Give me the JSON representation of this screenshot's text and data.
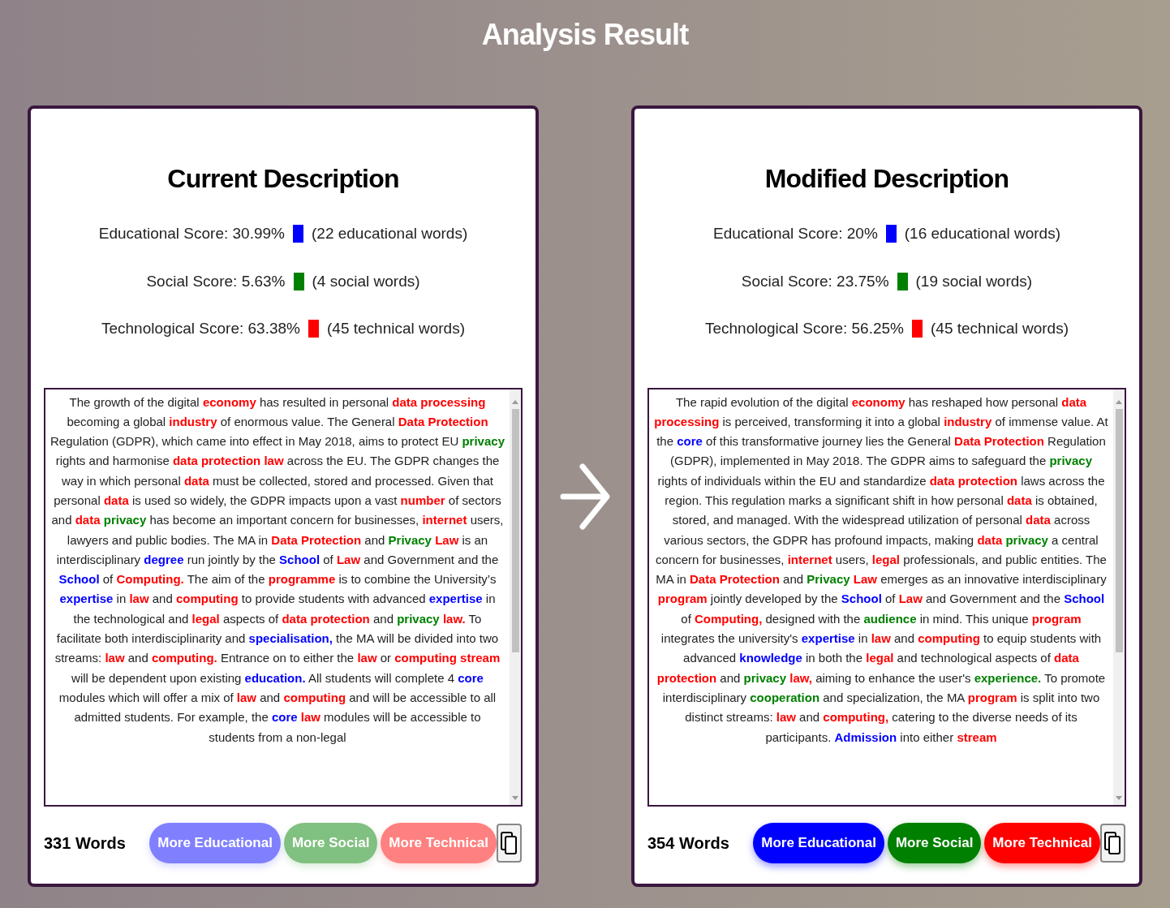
{
  "title": "Analysis Result",
  "panels": [
    {
      "heading": "Current Description",
      "scores": [
        {
          "label": "Educational Score: 30.99%",
          "color": "#0000ff",
          "count": "(22 educational words)"
        },
        {
          "label": "Social Score: 5.63%",
          "color": "#008000",
          "count": "(4 social words)"
        },
        {
          "label": "Technological Score: 63.38%",
          "color": "#ff0000",
          "count": "(45 technical words)"
        }
      ],
      "segments": [
        {
          "text": "The growth of the digital ",
          "kind": "plain"
        },
        {
          "text": "economy",
          "kind": "tech"
        },
        {
          "text": " has resulted in personal ",
          "kind": "plain"
        },
        {
          "text": "data processing",
          "kind": "tech"
        },
        {
          "text": " becoming a global ",
          "kind": "plain"
        },
        {
          "text": "industry",
          "kind": "tech"
        },
        {
          "text": " of enormous value. The General ",
          "kind": "plain"
        },
        {
          "text": "Data Protection",
          "kind": "tech"
        },
        {
          "text": " Regulation (GDPR), which came into effect in May 2018, aims to protect EU ",
          "kind": "plain"
        },
        {
          "text": "privacy",
          "kind": "social"
        },
        {
          "text": " rights and harmonise ",
          "kind": "plain"
        },
        {
          "text": "data protection law",
          "kind": "tech"
        },
        {
          "text": " across the EU. The GDPR changes the way in which personal ",
          "kind": "plain"
        },
        {
          "text": "data",
          "kind": "tech"
        },
        {
          "text": " must be collected, stored and processed. Given that personal ",
          "kind": "plain"
        },
        {
          "text": "data",
          "kind": "tech"
        },
        {
          "text": " is used so widely, the GDPR impacts upon a vast ",
          "kind": "plain"
        },
        {
          "text": "number",
          "kind": "tech"
        },
        {
          "text": " of sectors and ",
          "kind": "plain"
        },
        {
          "text": "data ",
          "kind": "tech"
        },
        {
          "text": "privacy",
          "kind": "social"
        },
        {
          "text": " has become an important concern for businesses, ",
          "kind": "plain"
        },
        {
          "text": "internet",
          "kind": "tech"
        },
        {
          "text": " users, lawyers and public bodies. The MA in ",
          "kind": "plain"
        },
        {
          "text": "Data Protection",
          "kind": "tech"
        },
        {
          "text": " and ",
          "kind": "plain"
        },
        {
          "text": "Privacy ",
          "kind": "social"
        },
        {
          "text": "Law",
          "kind": "tech"
        },
        {
          "text": " is an interdisciplinary ",
          "kind": "plain"
        },
        {
          "text": "degree",
          "kind": "edu"
        },
        {
          "text": " run jointly by the ",
          "kind": "plain"
        },
        {
          "text": "School",
          "kind": "edu"
        },
        {
          "text": " of ",
          "kind": "plain"
        },
        {
          "text": "Law",
          "kind": "tech"
        },
        {
          "text": " and Government and the ",
          "kind": "plain"
        },
        {
          "text": "School",
          "kind": "edu"
        },
        {
          "text": " of ",
          "kind": "plain"
        },
        {
          "text": "Computing.",
          "kind": "tech"
        },
        {
          "text": " The aim of the ",
          "kind": "plain"
        },
        {
          "text": "programme",
          "kind": "tech"
        },
        {
          "text": " is to combine the University’s ",
          "kind": "plain"
        },
        {
          "text": "expertise",
          "kind": "edu"
        },
        {
          "text": " in ",
          "kind": "plain"
        },
        {
          "text": "law",
          "kind": "tech"
        },
        {
          "text": " and ",
          "kind": "plain"
        },
        {
          "text": "computing",
          "kind": "tech"
        },
        {
          "text": " to provide students with advanced ",
          "kind": "plain"
        },
        {
          "text": "expertise",
          "kind": "edu"
        },
        {
          "text": " in the technological and ",
          "kind": "plain"
        },
        {
          "text": "legal",
          "kind": "tech"
        },
        {
          "text": " aspects of ",
          "kind": "plain"
        },
        {
          "text": "data protection",
          "kind": "tech"
        },
        {
          "text": " and ",
          "kind": "plain"
        },
        {
          "text": "privacy ",
          "kind": "social"
        },
        {
          "text": "law.",
          "kind": "tech"
        },
        {
          "text": " To facilitate both interdisciplinarity and ",
          "kind": "plain"
        },
        {
          "text": "specialisation,",
          "kind": "edu"
        },
        {
          "text": " the MA will be divided into two streams: ",
          "kind": "plain"
        },
        {
          "text": "law",
          "kind": "tech"
        },
        {
          "text": " and ",
          "kind": "plain"
        },
        {
          "text": "computing.",
          "kind": "tech"
        },
        {
          "text": " Entrance on to either the ",
          "kind": "plain"
        },
        {
          "text": "law",
          "kind": "tech"
        },
        {
          "text": " or ",
          "kind": "plain"
        },
        {
          "text": "computing stream",
          "kind": "tech"
        },
        {
          "text": " will be dependent upon existing ",
          "kind": "plain"
        },
        {
          "text": "education.",
          "kind": "edu"
        },
        {
          "text": " All students will complete 4 ",
          "kind": "plain"
        },
        {
          "text": "core",
          "kind": "edu"
        },
        {
          "text": " modules which will offer a mix of ",
          "kind": "plain"
        },
        {
          "text": "law",
          "kind": "tech"
        },
        {
          "text": " and ",
          "kind": "plain"
        },
        {
          "text": "computing",
          "kind": "tech"
        },
        {
          "text": " and will be accessible to all admitted students. For example, the ",
          "kind": "plain"
        },
        {
          "text": "core ",
          "kind": "edu"
        },
        {
          "text": "law",
          "kind": "tech"
        },
        {
          "text": " modules will be accessible to students from a non-legal",
          "kind": "plain"
        }
      ],
      "word_count": "331 Words",
      "buttons": [
        {
          "label": "More Educational",
          "kind": "edu",
          "disabled": true
        },
        {
          "label": "More Social",
          "kind": "social",
          "disabled": true
        },
        {
          "label": "More Technical",
          "kind": "tech",
          "disabled": true
        }
      ]
    },
    {
      "heading": "Modified Description",
      "scores": [
        {
          "label": "Educational Score: 20%",
          "color": "#0000ff",
          "count": "(16 educational words)"
        },
        {
          "label": "Social Score: 23.75%",
          "color": "#008000",
          "count": "(19 social words)"
        },
        {
          "label": "Technological Score: 56.25%",
          "color": "#ff0000",
          "count": "(45 technical words)"
        }
      ],
      "segments": [
        {
          "text": "The rapid evolution of the digital ",
          "kind": "plain"
        },
        {
          "text": "economy",
          "kind": "tech"
        },
        {
          "text": " has reshaped how personal ",
          "kind": "plain"
        },
        {
          "text": "data processing",
          "kind": "tech"
        },
        {
          "text": " is perceived, transforming it into a global ",
          "kind": "plain"
        },
        {
          "text": "industry",
          "kind": "tech"
        },
        {
          "text": " of immense value. At the ",
          "kind": "plain"
        },
        {
          "text": "core",
          "kind": "edu"
        },
        {
          "text": " of this transformative journey lies the General ",
          "kind": "plain"
        },
        {
          "text": "Data Protection",
          "kind": "tech"
        },
        {
          "text": " Regulation (GDPR), implemented in May 2018. The GDPR aims to safeguard the ",
          "kind": "plain"
        },
        {
          "text": "privacy",
          "kind": "social"
        },
        {
          "text": " rights of individuals within the EU and standardize ",
          "kind": "plain"
        },
        {
          "text": "data protection",
          "kind": "tech"
        },
        {
          "text": " laws across the region. This regulation marks a significant shift in how personal ",
          "kind": "plain"
        },
        {
          "text": "data",
          "kind": "tech"
        },
        {
          "text": " is obtained, stored, and managed. With the widespread utilization of personal ",
          "kind": "plain"
        },
        {
          "text": "data",
          "kind": "tech"
        },
        {
          "text": " across various sectors, the GDPR has profound impacts, making ",
          "kind": "plain"
        },
        {
          "text": "data ",
          "kind": "tech"
        },
        {
          "text": "privacy",
          "kind": "social"
        },
        {
          "text": " a central concern for businesses, ",
          "kind": "plain"
        },
        {
          "text": "internet",
          "kind": "tech"
        },
        {
          "text": " users, ",
          "kind": "plain"
        },
        {
          "text": "legal",
          "kind": "tech"
        },
        {
          "text": " professionals, and public entities. The MA in ",
          "kind": "plain"
        },
        {
          "text": "Data Protection",
          "kind": "tech"
        },
        {
          "text": " and ",
          "kind": "plain"
        },
        {
          "text": "Privacy ",
          "kind": "social"
        },
        {
          "text": "Law",
          "kind": "tech"
        },
        {
          "text": " emerges as an innovative interdisciplinary ",
          "kind": "plain"
        },
        {
          "text": "program",
          "kind": "tech"
        },
        {
          "text": " jointly developed by the ",
          "kind": "plain"
        },
        {
          "text": "School",
          "kind": "edu"
        },
        {
          "text": " of ",
          "kind": "plain"
        },
        {
          "text": "Law",
          "kind": "tech"
        },
        {
          "text": " and Government and the ",
          "kind": "plain"
        },
        {
          "text": "School",
          "kind": "edu"
        },
        {
          "text": " of ",
          "kind": "plain"
        },
        {
          "text": "Computing,",
          "kind": "tech"
        },
        {
          "text": " designed with the ",
          "kind": "plain"
        },
        {
          "text": "audience",
          "kind": "social"
        },
        {
          "text": " in mind. This unique ",
          "kind": "plain"
        },
        {
          "text": "program",
          "kind": "tech"
        },
        {
          "text": " integrates the university's ",
          "kind": "plain"
        },
        {
          "text": "expertise",
          "kind": "edu"
        },
        {
          "text": " in ",
          "kind": "plain"
        },
        {
          "text": "law",
          "kind": "tech"
        },
        {
          "text": " and ",
          "kind": "plain"
        },
        {
          "text": "computing",
          "kind": "tech"
        },
        {
          "text": " to equip students with advanced ",
          "kind": "plain"
        },
        {
          "text": "knowledge",
          "kind": "edu"
        },
        {
          "text": " in both the ",
          "kind": "plain"
        },
        {
          "text": "legal",
          "kind": "tech"
        },
        {
          "text": " and technological aspects of ",
          "kind": "plain"
        },
        {
          "text": "data protection",
          "kind": "tech"
        },
        {
          "text": " and ",
          "kind": "plain"
        },
        {
          "text": "privacy ",
          "kind": "social"
        },
        {
          "text": "law,",
          "kind": "tech"
        },
        {
          "text": " aiming to enhance the user's ",
          "kind": "plain"
        },
        {
          "text": "experience.",
          "kind": "social"
        },
        {
          "text": " To promote interdisciplinary ",
          "kind": "plain"
        },
        {
          "text": "cooperation",
          "kind": "social"
        },
        {
          "text": " and specialization, the MA ",
          "kind": "plain"
        },
        {
          "text": "program",
          "kind": "tech"
        },
        {
          "text": " is split into two distinct streams: ",
          "kind": "plain"
        },
        {
          "text": "law",
          "kind": "tech"
        },
        {
          "text": " and ",
          "kind": "plain"
        },
        {
          "text": "computing,",
          "kind": "tech"
        },
        {
          "text": " catering to the diverse needs of its participants. ",
          "kind": "plain"
        },
        {
          "text": "Admission",
          "kind": "edu"
        },
        {
          "text": " into either ",
          "kind": "plain"
        },
        {
          "text": "stream",
          "kind": "tech"
        }
      ],
      "word_count": "354 Words",
      "buttons": [
        {
          "label": "More Educational",
          "kind": "edu",
          "disabled": false
        },
        {
          "label": "More Social",
          "kind": "social",
          "disabled": false
        },
        {
          "label": "More Technical",
          "kind": "tech",
          "disabled": false
        }
      ]
    }
  ]
}
